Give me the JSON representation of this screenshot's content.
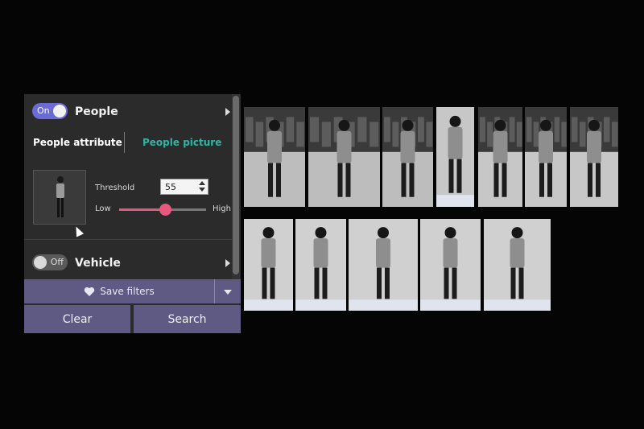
{
  "people": {
    "toggle_label": "On",
    "title": "People",
    "tabs": [
      "People attribute",
      "People picture"
    ],
    "threshold_label": "Threshold",
    "threshold_value": "55",
    "slider_low": "Low",
    "slider_high": "High",
    "slider_fraction": 0.55
  },
  "vehicle": {
    "toggle_label": "Off",
    "title": "Vehicle"
  },
  "actions": {
    "save_filters": "Save filters",
    "clear": "Clear",
    "search": "Search"
  },
  "colors": {
    "accent": "#6b6bd6",
    "tab_inactive": "#2fb5a4",
    "slider": "#e8587d",
    "button": "#5e5a84"
  },
  "results": {
    "row1_count": 7,
    "row2_count": 5
  }
}
